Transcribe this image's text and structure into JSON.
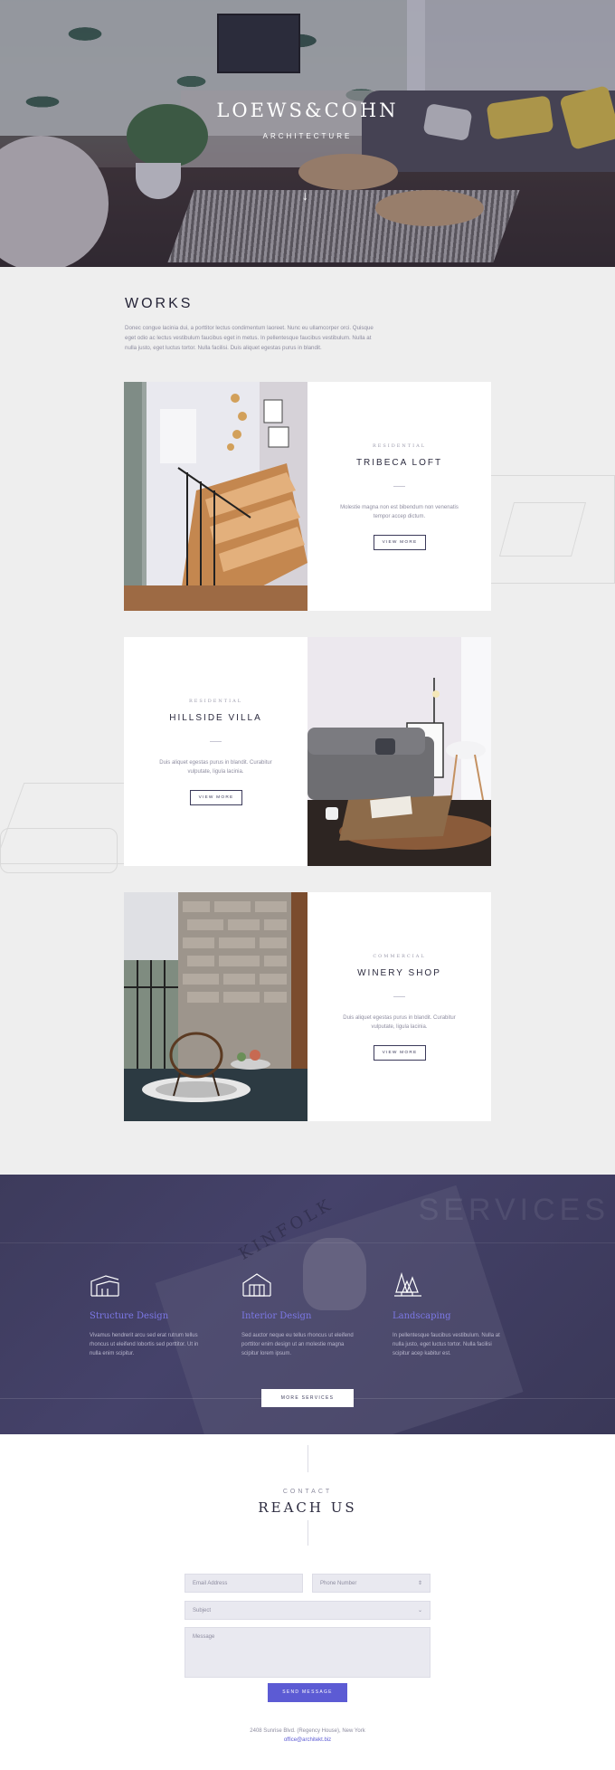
{
  "hero": {
    "brand": "LOEWS&COHN",
    "tagline": "ARCHITECTURE",
    "scroll_icon": "arrow-down-icon"
  },
  "works": {
    "heading": "WORKS",
    "intro": "Donec congue lacinia dui, a porttitor lectus condimentum laoreet. Nunc eu ullamcorper orci. Quisque eget odio ac lectus vestibulum faucibus eget in metus. In pellentesque faucibus vestibulum. Nulla at nulla justo, eget luctus tortor. Nulla facilisi. Duis aliquet egestas purus in blandit.",
    "projects": [
      {
        "category": "RESIDENTIAL",
        "title": "TRIBECA LOFT",
        "description": "Molestie magna non est bibendum non venenatis tempor accep dictum.",
        "button": "VIEW MORE"
      },
      {
        "category": "RESIDENTIAL",
        "title": "HILLSIDE VILLA",
        "description": "Duis aliquet egestas purus in blandit. Curabitur vulputate, ligula lacinia.",
        "button": "VIEW MORE"
      },
      {
        "category": "COMMERCIAL",
        "title": "WINERY SHOP",
        "description": "Duis aliquet egestas purus in blandit. Curabitur vulputate, ligula lacinia.",
        "button": "VIEW MORE"
      }
    ]
  },
  "services": {
    "watermark": "SERVICES",
    "book_title": "KINFOLK",
    "items": [
      {
        "icon": "structure-icon",
        "name": "Structure Design",
        "description": "Vivamus hendrerit arcu sed erat rutrum tellus rhoncus ut eleifend lobortis sed porttitor. Ut in nulla enim scipitur."
      },
      {
        "icon": "interior-icon",
        "name": "Interior Design",
        "description": "Sed auctor neque eu tellus rhoncus ut eleifend porttitor enim design ut an molestie magna scipitur lorem ipsum."
      },
      {
        "icon": "landscaping-icon",
        "name": "Landscaping",
        "description": "In pellentesque faucibus vestibulum. Nulla at nulla justo, eget luctus tortor. Nulla facilisi scipitur acep kabitur est."
      }
    ],
    "more_button": "MORE SERVICES"
  },
  "contact": {
    "eyebrow": "CONTACT",
    "heading": "REACH US",
    "email_placeholder": "Email Address",
    "phone_placeholder": "Phone Number",
    "subject_placeholder": "Subject",
    "message_placeholder": "Message",
    "send_button": "SEND MESSAGE",
    "address": "2408 Sunrise Blvd. (Regency House), New York",
    "email": "office@architekt.biz"
  },
  "colors": {
    "accent": "#5c5bd4",
    "services_bg": "#3d3b5c",
    "works_bg": "#eeeeee",
    "service_title": "#7c78e6"
  }
}
